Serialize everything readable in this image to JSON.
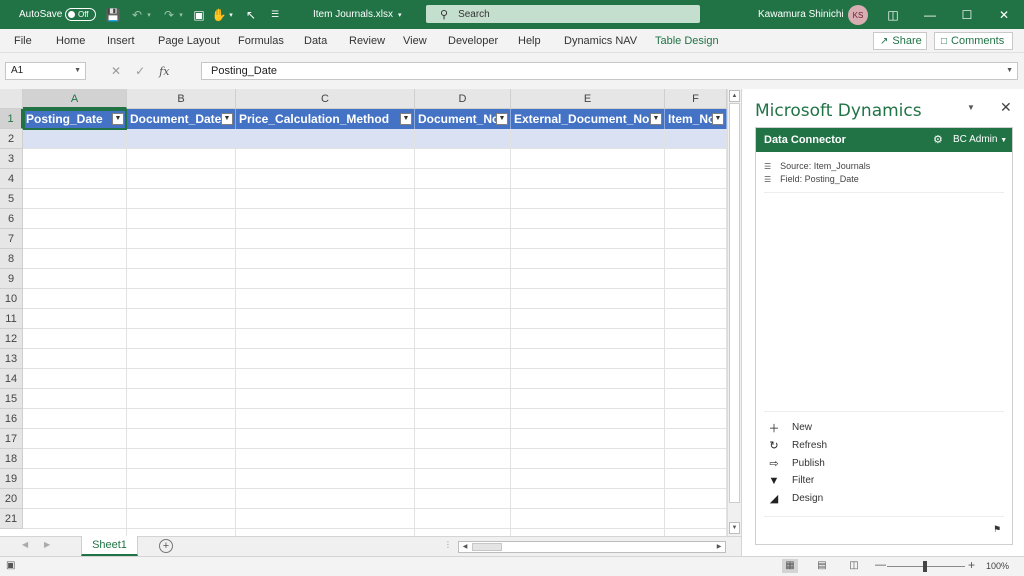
{
  "titlebar": {
    "autosave_label": "AutoSave",
    "autosave_state": "Off",
    "file_name": "Item Journals.xlsx",
    "search_placeholder": "Search",
    "user_name": "Kawamura Shinichi",
    "user_initials": "KS",
    "icons": [
      "save-icon",
      "undo-icon",
      "redo-icon",
      "camera-icon",
      "touch-mode-icon",
      "pointer-icon",
      "customize-icon"
    ]
  },
  "ribbon": {
    "tabs": [
      "File",
      "Home",
      "Insert",
      "Page Layout",
      "Formulas",
      "Data",
      "Review",
      "View",
      "Developer",
      "Help",
      "Dynamics NAV",
      "Table Design"
    ],
    "share_label": "Share",
    "comments_label": "Comments"
  },
  "formula_bar": {
    "name_box": "A1",
    "formula": "Posting_Date"
  },
  "grid": {
    "columns": [
      "A",
      "B",
      "C",
      "D",
      "E",
      "F"
    ],
    "rows": [
      "1",
      "2",
      "3",
      "4",
      "5",
      "6",
      "7",
      "8",
      "9",
      "10",
      "11",
      "12",
      "13",
      "14",
      "15",
      "16",
      "17",
      "18",
      "19",
      "20",
      "21"
    ],
    "table_headers": [
      "Posting_Date",
      "Document_Date",
      "Price_Calculation_Method",
      "Document_No",
      "External_Document_No",
      "Item_No"
    ],
    "active_cell": "A1"
  },
  "sheets": {
    "tabs": [
      "Sheet1"
    ],
    "active": "Sheet1"
  },
  "task_pane": {
    "title": "Microsoft Dynamics",
    "connector_title": "Data Connector",
    "connector_user": "BC Admin",
    "source": "Source: Item_Journals",
    "field": "Field: Posting_Date",
    "actions": [
      {
        "label": "New",
        "icon": "plus-icon"
      },
      {
        "label": "Refresh",
        "icon": "refresh-icon"
      },
      {
        "label": "Publish",
        "icon": "publish-icon"
      },
      {
        "label": "Filter",
        "icon": "filter-icon"
      },
      {
        "label": "Design",
        "icon": "design-icon"
      }
    ]
  },
  "status_bar": {
    "zoom": "100%",
    "view_modes": [
      "normal-view",
      "page-layout-view",
      "page-break-view"
    ],
    "active_view": "normal-view"
  },
  "colors": {
    "excel_green": "#217346",
    "table_header_blue": "#4472c4",
    "table_band": "#d9e1f2"
  }
}
